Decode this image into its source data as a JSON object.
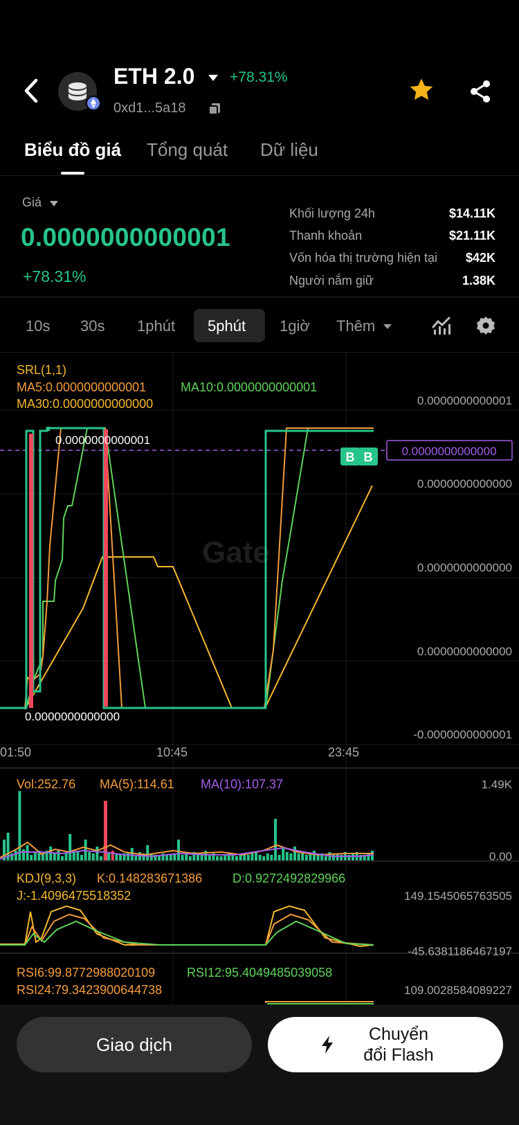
{
  "header": {
    "token_name": "ETH 2.0",
    "change": "+78.31%",
    "address": "0xd1...5a18"
  },
  "tabs": [
    "Biểu đồ giá",
    "Tổng quát",
    "Dữ liệu"
  ],
  "price": {
    "label": "Giá",
    "value": "0.0000000000001",
    "change": "+78.31%"
  },
  "stats": [
    {
      "label": "Khối lượng 24h",
      "value": "$14.11K"
    },
    {
      "label": "Thanh khoản",
      "value": "$21.11K"
    },
    {
      "label": "Vốn hóa thị trường hiện tại",
      "value": "$42K"
    },
    {
      "label": "Người nắm giữ",
      "value": "1.38K"
    }
  ],
  "timeframes": [
    "10s",
    "30s",
    "1phút",
    "5phút",
    "1giờ",
    "Thêm"
  ],
  "active_timeframe": "5phút",
  "chart_legend": {
    "srl": "SRL(1,1)",
    "ma5": "MA5:0.0000000000001",
    "ma10": "MA10:0.0000000000001",
    "ma30": "MA30:0.0000000000000"
  },
  "chart_axis": {
    "y_labels": [
      "0.0000000000001",
      "0.0000000000000",
      "0.0000000000000",
      "0.0000000000000",
      "-0.0000000000001"
    ],
    "current_price_tag": "0.0000000000000",
    "high_label": "0.0000000000001",
    "low_label": "0.0000000000000",
    "x_labels": [
      "01:50",
      "10:45",
      "23:45"
    ],
    "buy_markers": [
      "B",
      "B"
    ],
    "watermark": "Gate"
  },
  "volume": {
    "vol": "Vol:252.76",
    "ma5": "MA(5):114.61",
    "ma10": "MA(10):107.37",
    "max_label": "1.49K",
    "min_label": "0.00"
  },
  "kdj": {
    "title": "KDJ(9,3,3)",
    "k": "K:0.148283671386",
    "d": "D:0.9272492829966",
    "j": "J:-1.4096475518352",
    "max_label": "149.1545065763505",
    "min_label": "-45.6381186467197"
  },
  "rsi": {
    "rsi6": "RSI6:99.8772988020109",
    "rsi12": "RSI12:95.4049485039058",
    "rsi24": "RSI24:79.3423900644738",
    "max_label": "109.0028584089227"
  },
  "actions": {
    "trade": "Giao dịch",
    "flash_line1": "Chuyển",
    "flash_line2": "đổi Flash"
  },
  "colors": {
    "up": "#27c48a",
    "down": "#f0485b",
    "ma5": "#f39c3d",
    "ma10": "#5fd25a",
    "ma30": "#f5b92e",
    "purple": "#a45ee8",
    "star": "#f5b31a"
  }
}
